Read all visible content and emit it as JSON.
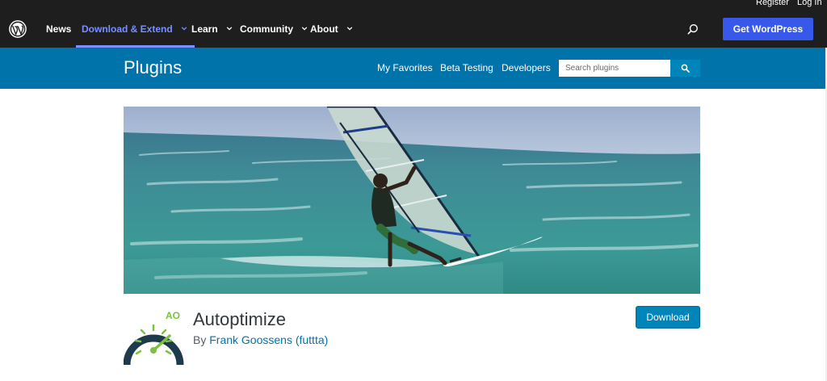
{
  "utility": {
    "register": "Register",
    "login": "Log In"
  },
  "global_nav": {
    "items": [
      {
        "label": "News",
        "has_dropdown": false,
        "active": false
      },
      {
        "label": "Download & Extend",
        "has_dropdown": true,
        "active": true
      },
      {
        "label": "Learn",
        "has_dropdown": true,
        "active": false
      },
      {
        "label": "Community",
        "has_dropdown": true,
        "active": false
      },
      {
        "label": "About",
        "has_dropdown": true,
        "active": false
      }
    ],
    "cta": "Get WordPress",
    "search_icon": "search-icon",
    "logo_icon": "wordpress-logo-icon"
  },
  "plugins_bar": {
    "title": "Plugins",
    "links": [
      "My Favorites",
      "Beta Testing",
      "Developers"
    ],
    "search_placeholder": "Search plugins"
  },
  "plugin": {
    "name": "Autoptimize",
    "by": "By",
    "author": "Frank Goossens (futtta)",
    "icon_text": "AO",
    "download_label": "Download"
  },
  "colors": {
    "header_bg": "#1e1e1e",
    "accent": "#3858e9",
    "active_nav": "#7b90ff",
    "plugins_bar": "#0073aa",
    "button": "#0085ba",
    "icon_green": "#7cc142",
    "icon_navy": "#1e3b4d"
  }
}
